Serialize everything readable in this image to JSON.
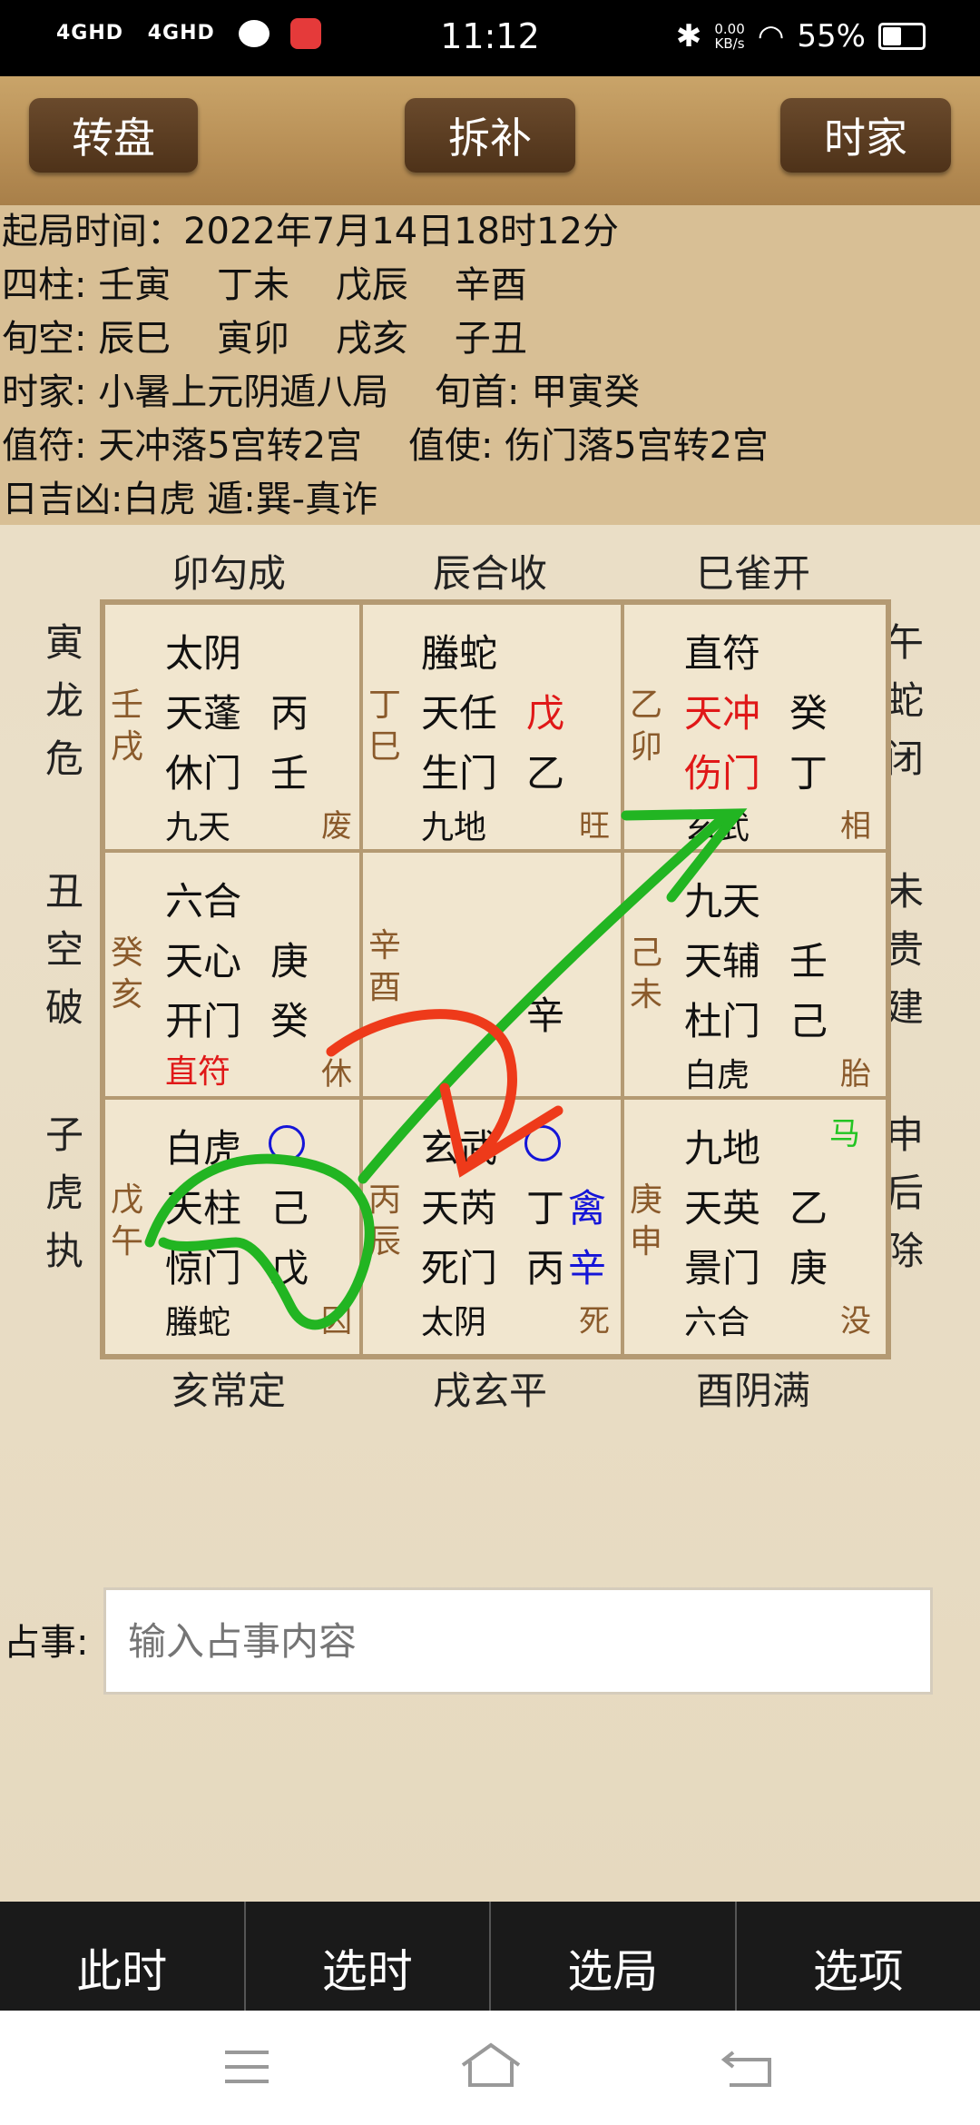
{
  "status": {
    "left_signals": [
      "4GHD",
      "4GHD"
    ],
    "time": "11:12",
    "net_speed": "0.00\nKB/s",
    "battery": "55%",
    "battery_level": 0.55
  },
  "toolbar": {
    "rotate": "转盘",
    "split": "拆补",
    "mode": "时家"
  },
  "info": {
    "line1": "起局时间：2022年7月14日18时12分",
    "line2": "四柱: 壬寅    丁未    戊辰    辛酉",
    "line3": "旬空: 辰巳    寅卯    戌亥    子丑",
    "line4": "时家: 小暑上元阴遁八局    旬首: 甲寅癸",
    "line5": "值符: 天冲落5宫转2宫    值使: 伤门落5宫转2宫",
    "line6": "日吉凶:白虎 遁:巽-真诈"
  },
  "labels": {
    "top": [
      "卯勾成",
      "辰合收",
      "巳雀开"
    ],
    "bottom": [
      "亥常定",
      "戌玄平",
      "酉阴满"
    ],
    "left": [
      "寅龙危",
      "丑空破",
      "子虎执"
    ],
    "right": [
      "午蛇闭",
      "未贵建",
      "申后除"
    ]
  },
  "cells": {
    "c00": {
      "god": "太阴",
      "star": "天蓬",
      "star_stem": "丙",
      "door": "休门",
      "door_stem": "壬",
      "sky": "九天",
      "side": "壬戌",
      "state": "废"
    },
    "c01": {
      "god": "螣蛇",
      "star": "天任",
      "star_stem": "戊",
      "door": "生门",
      "door_stem": "乙",
      "sky": "九地",
      "side": "丁巳",
      "state": "旺"
    },
    "c02": {
      "god": "直符",
      "star": "天冲",
      "star_stem": "癸",
      "door": "伤门",
      "door_stem": "丁",
      "sky": "玄武",
      "side": "乙卯",
      "state": "相"
    },
    "c10": {
      "god": "六合",
      "star": "天心",
      "star_stem": "庚",
      "door": "开门",
      "door_stem": "癸",
      "sky": "直符",
      "side": "癸亥",
      "state": "休"
    },
    "c11": {
      "side": "辛酉",
      "center_stem": "辛"
    },
    "c12": {
      "god": "九天",
      "star": "天辅",
      "star_stem": "壬",
      "door": "杜门",
      "door_stem": "己",
      "sky": "白虎",
      "side": "己未",
      "state": "胎"
    },
    "c20": {
      "god": "白虎",
      "star": "天柱",
      "star_stem": "己",
      "door": "惊门",
      "door_stem": "戊",
      "sky": "螣蛇",
      "side": "戊午",
      "state": "囚"
    },
    "c21": {
      "god": "玄武",
      "star": "天芮",
      "star_stem": "丁",
      "door": "死门",
      "door_stem": "丙",
      "sky": "太阴",
      "side": "丙辰",
      "state": "死",
      "extra1": "禽",
      "extra2": "辛"
    },
    "c22": {
      "god": "九地",
      "star": "天英",
      "star_stem": "乙",
      "door": "景门",
      "door_stem": "庚",
      "sky": "六合",
      "side": "庚申",
      "state": "没",
      "horse": "马"
    }
  },
  "ask": {
    "label": "占事:",
    "placeholder": "输入占事内容"
  },
  "bottom": {
    "now": "此时",
    "pick_time": "选时",
    "pick_ju": "选局",
    "options": "选项"
  },
  "colors": {
    "toolbar": "#b78e55",
    "info_bg": "#d8bf95",
    "red": "#e01818",
    "blue": "#1515d8",
    "green": "#22c422"
  }
}
